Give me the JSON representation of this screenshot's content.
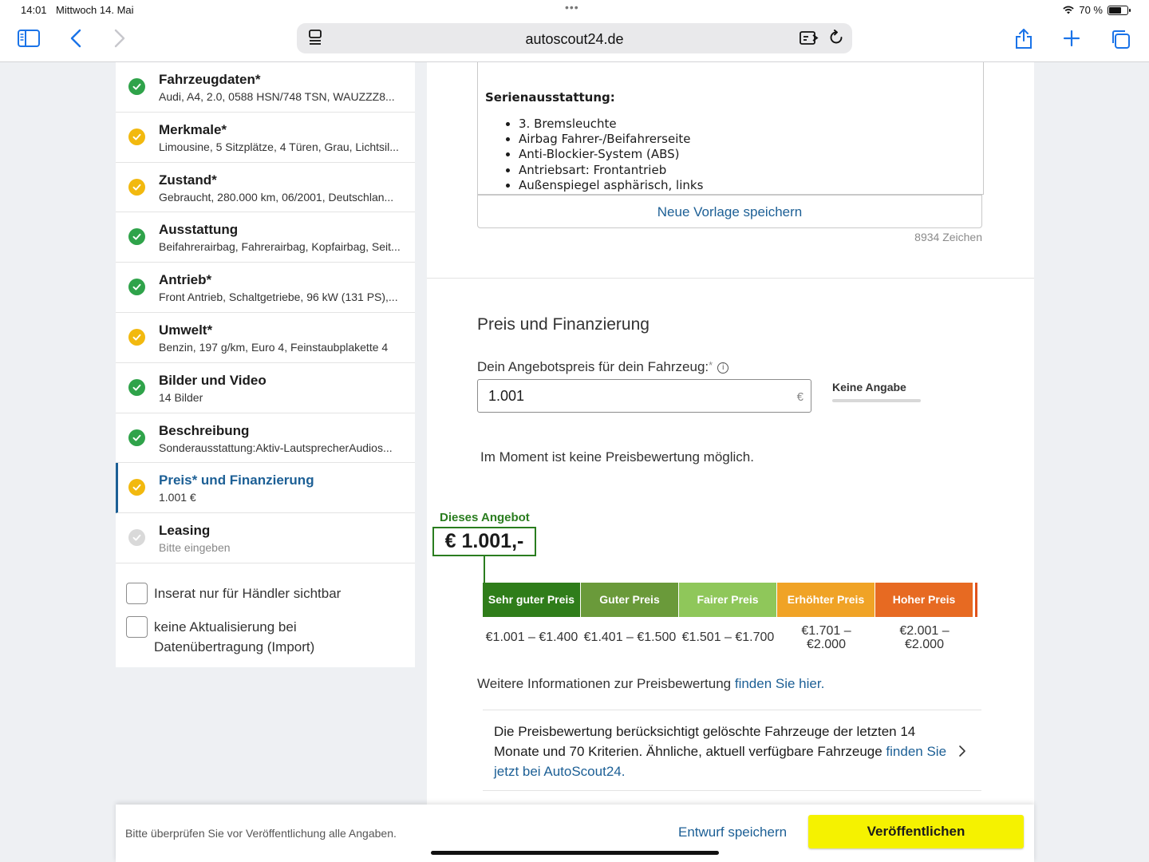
{
  "status": {
    "time": "14:01",
    "date": "Mittwoch 14. Mai",
    "battery": "70 %"
  },
  "browser": {
    "url": "autoscout24.de"
  },
  "sidebar": {
    "steps": [
      {
        "title": "Fahrzeugdaten*",
        "sub": "Audi, A4, 2.0, 0588 HSN/748 TSN, WAUZZZ8...",
        "status": "done"
      },
      {
        "title": "Merkmale*",
        "sub": "Limousine, 5 Sitzplätze, 4 Türen, Grau, Lichtsil...",
        "status": "warn"
      },
      {
        "title": "Zustand*",
        "sub": "Gebraucht, 280.000 km, 06/2001, Deutschlan...",
        "status": "warn"
      },
      {
        "title": "Ausstattung",
        "sub": "Beifahrerairbag, Fahrerairbag, Kopfairbag, Seit...",
        "status": "done"
      },
      {
        "title": "Antrieb*",
        "sub": "Front Antrieb, Schaltgetriebe, 96 kW (131 PS),...",
        "status": "done"
      },
      {
        "title": "Umwelt*",
        "sub": "Benzin, 197 g/km, Euro 4, Feinstaubplakette 4",
        "status": "warn"
      },
      {
        "title": "Bilder und Video",
        "sub": "14 Bilder",
        "status": "done"
      },
      {
        "title": "Beschreibung",
        "sub": "Sonderausstattung:Aktiv-LautsprecherAudios...",
        "status": "done"
      },
      {
        "title": "Preis* und Finanzierung",
        "sub": "1.001 €",
        "status": "warn"
      },
      {
        "title": "Leasing",
        "sub": "Bitte eingeben",
        "status": "empty"
      }
    ],
    "checkbox_dealer": "Inserat nur für Händler sichtbar",
    "checkbox_import_1": "keine Aktualisierung bei",
    "checkbox_import_2": "Datenübertragung (Import)"
  },
  "description": {
    "heading": "Serienausstattung:",
    "items": [
      "3. Bremsleuchte",
      "Airbag Fahrer-/Beifahrerseite",
      "Anti-Blockier-System (ABS)",
      "Antriebsart: Frontantrieb",
      "Außenspiegel asphärisch, links"
    ],
    "save_template": "Neue Vorlage speichern",
    "char_count": "8934 Zeichen"
  },
  "price": {
    "section_title": "Preis und Finanzierung",
    "label": "Dein Angebotspreis für dein Fahrzeug:",
    "required_mark": "*",
    "info_icon": "i",
    "value": "1.001",
    "currency": "€",
    "no_info": "Keine Angabe",
    "no_rating": "Im Moment ist keine Preisbewertung möglich.",
    "offer_label": "Dieses Angebot",
    "offer_value": "€ 1.001,-",
    "scale": [
      {
        "label": "Sehr guter Preis",
        "range_1": "€1.001 – €1.400",
        "range_2": "",
        "color": "#2f7d1a"
      },
      {
        "label": "Guter Preis",
        "range_1": "€1.401 – €1.500",
        "range_2": "",
        "color": "#6a9a3a"
      },
      {
        "label": "Fairer Preis",
        "range_1": "€1.501 – €1.700",
        "range_2": "",
        "color": "#8fc75a"
      },
      {
        "label": "Erhöhter Preis",
        "range_1": "€1.701 –",
        "range_2": "€2.000",
        "color": "#f0a326"
      },
      {
        "label": "Hoher Preis",
        "range_1": "€2.001 –",
        "range_2": "€2.000",
        "color": "#e76a22"
      }
    ],
    "more_info_text": "Weitere Informationen zur Preisbewertung ",
    "more_info_link": "finden Sie hier.",
    "long_text": "Die Preisbewertung berücksichtigt gelöschte Fahrzeuge der letzten 14 Monate und 70 Kriterien. Ähnliche, aktuell verfügbare Fahrzeuge ",
    "long_link": "finden Sie jetzt bei AutoScout24."
  },
  "footer": {
    "hint": "Bitte überprüfen Sie vor Veröffentlichung alle Angaben.",
    "draft": "Entwurf speichern",
    "publish": "Veröffentlichen"
  },
  "colors": {
    "done": "#2fa34a",
    "warn": "#f2b90f",
    "empty": "#d9d9d9",
    "accent": "#1c5f95",
    "publish": "#f5f200"
  }
}
